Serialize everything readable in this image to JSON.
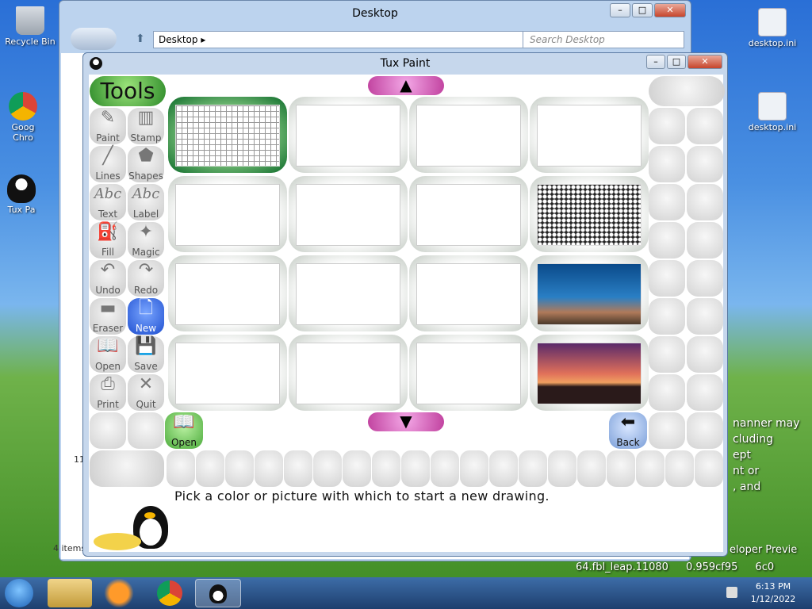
{
  "desktop": {
    "icons": [
      {
        "label": "Recycle Bin"
      },
      {
        "label": "Goog Chro"
      },
      {
        "label": "Tux Pa"
      },
      {
        "label": "desktop.ini"
      },
      {
        "label": "desktop.ini"
      }
    ],
    "right_text": [
      "nanner may",
      "cluding",
      "ept",
      "nt or",
      ", and"
    ],
    "watermark": [
      "eloper Previe",
      "64.fbl_leap.11080",
      "0.959cf95",
      "6c0"
    ]
  },
  "explorer": {
    "title": "Desktop",
    "address": "Desktop",
    "search_placeholder": "Search Desktop",
    "status_items": "4 items",
    "side_num": "11"
  },
  "tuxpaint": {
    "title": "Tux Paint",
    "tools_header": "Tools",
    "tools": [
      {
        "label": "Paint",
        "icon": "brush"
      },
      {
        "label": "Stamp",
        "icon": "stamp"
      },
      {
        "label": "Lines",
        "icon": "lines"
      },
      {
        "label": "Shapes",
        "icon": "pentagon"
      },
      {
        "label": "Text",
        "icon": "Abc"
      },
      {
        "label": "Label",
        "icon": "Abc"
      },
      {
        "label": "Fill",
        "icon": "bucket"
      },
      {
        "label": "Magic",
        "icon": "wand"
      },
      {
        "label": "Undo",
        "icon": "undo"
      },
      {
        "label": "Redo",
        "icon": "redo"
      },
      {
        "label": "Eraser",
        "icon": "eraser"
      },
      {
        "label": "New",
        "icon": "new-page"
      },
      {
        "label": "Open",
        "icon": "book"
      },
      {
        "label": "Save",
        "icon": "save"
      },
      {
        "label": "Print",
        "icon": "printer"
      },
      {
        "label": "Quit",
        "icon": "quit"
      }
    ],
    "open_label": "Open",
    "back_label": "Back",
    "message": "Pick a color or picture with which to start a new drawing."
  },
  "taskbar": {
    "time": "6:13 PM",
    "date": "1/12/2022"
  }
}
